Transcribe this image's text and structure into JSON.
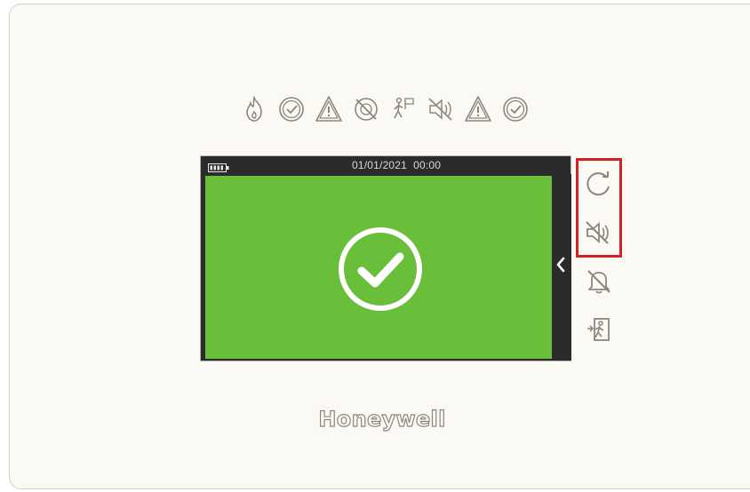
{
  "device": {
    "brand": "Honeywell",
    "datetime": "01/01/2021  00:00",
    "system_state": "normal",
    "status_icons": [
      "fire-icon",
      "ok-check-icon",
      "fault-warning-icon",
      "disabled-icon",
      "test-mode-icon",
      "sounders-silenced-icon",
      "warning-icon",
      "power-ok-icon"
    ],
    "side_buttons": [
      "reset-icon",
      "silence-sounders-icon",
      "silence-buzzer-icon",
      "evacuate-icon"
    ],
    "highlighted_buttons": [
      "reset-icon",
      "silence-sounders-icon"
    ],
    "colors": {
      "screen_ok": "#6abf3a",
      "highlight": "#d71f26",
      "panel": "#fbf9f3"
    }
  }
}
